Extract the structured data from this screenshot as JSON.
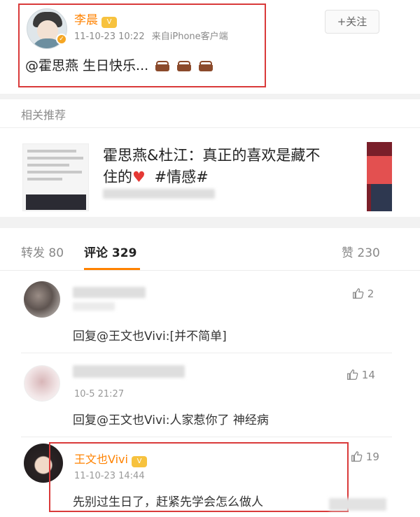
{
  "post": {
    "username": "李晨",
    "vip_label": "V",
    "timestamp": "11-10-23 10:22",
    "source": "来自iPhone客户端",
    "text": "@霍思燕 生日快乐...",
    "follow_label": "+关注"
  },
  "related": {
    "section_title": "相关推荐",
    "title_line1": "霍思燕&杜江：真正的喜欢是藏不",
    "title_line2_a": "住的",
    "title_line2_b": "#情感#"
  },
  "tabs": {
    "repost": "转发 80",
    "comments": "评论 329",
    "likes": "赞 230"
  },
  "comments": [
    {
      "likes": "2",
      "text": "回复@王文也Vivi:[并不简单]"
    },
    {
      "time": "10-5 21:27",
      "likes": "14",
      "text": "回复@王文也Vivi:人家惹你了 神经病"
    },
    {
      "name": "王文也Vivi",
      "time": "11-10-23 14:44",
      "likes": "19",
      "text": "先别过生日了，赶紧先学会怎么做人"
    }
  ],
  "colors": {
    "accent": "#ff8200",
    "highlight_box": "#d93a3a"
  }
}
